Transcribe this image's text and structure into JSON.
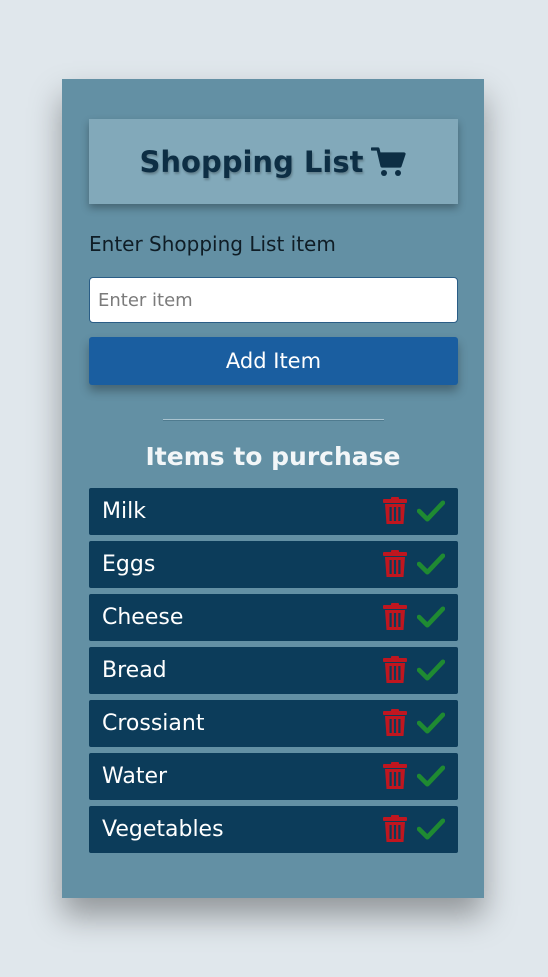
{
  "header": {
    "title": "Shopping List",
    "icon": "cart-icon"
  },
  "form": {
    "label": "Enter Shopping List item",
    "placeholder": "Enter item",
    "value": "",
    "button_label": "Add Item"
  },
  "list": {
    "heading": "Items to purchase",
    "items": [
      {
        "name": "Milk"
      },
      {
        "name": "Eggs"
      },
      {
        "name": "Cheese"
      },
      {
        "name": "Bread"
      },
      {
        "name": "Crossiant"
      },
      {
        "name": "Water"
      },
      {
        "name": "Vegetables"
      }
    ],
    "delete_icon": "trash-icon",
    "done_icon": "check-icon"
  },
  "colors": {
    "page_background": "#e0e7ec",
    "card": "#6390a4",
    "title_box": "#82a9ba",
    "button": "#1a5ea0",
    "item_background": "#0c3c5a",
    "delete": "#c0161f",
    "done": "#1f8a32"
  }
}
